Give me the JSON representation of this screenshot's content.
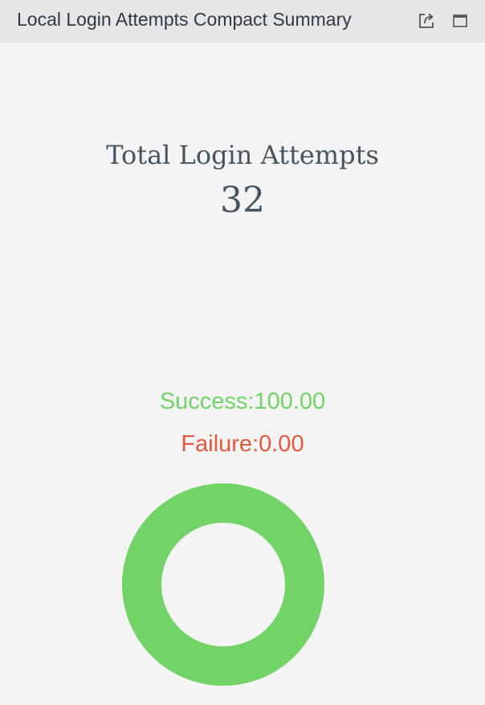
{
  "panel": {
    "title": "Local Login Attempts Compact Summary",
    "buttons": {
      "export_icon": "export-icon",
      "maximize_icon": "maximize-icon"
    }
  },
  "summary": {
    "label": "Total Login Attempts",
    "value": "32"
  },
  "legend": {
    "success_label": "Success:",
    "success_value": "100.00",
    "failure_label": "Failure:",
    "failure_value": "0.00"
  },
  "chart_data": {
    "type": "pie",
    "categories": [
      "Success",
      "Failure"
    ],
    "values": [
      100.0,
      0.0
    ],
    "colors": [
      "#72d366",
      "#e2593f"
    ]
  },
  "colors": {
    "header_bg": "#e6e6e6",
    "panel_bg": "#f4f4f4",
    "text_dark": "#455560",
    "success": "#72d366",
    "failure": "#e2593f"
  }
}
